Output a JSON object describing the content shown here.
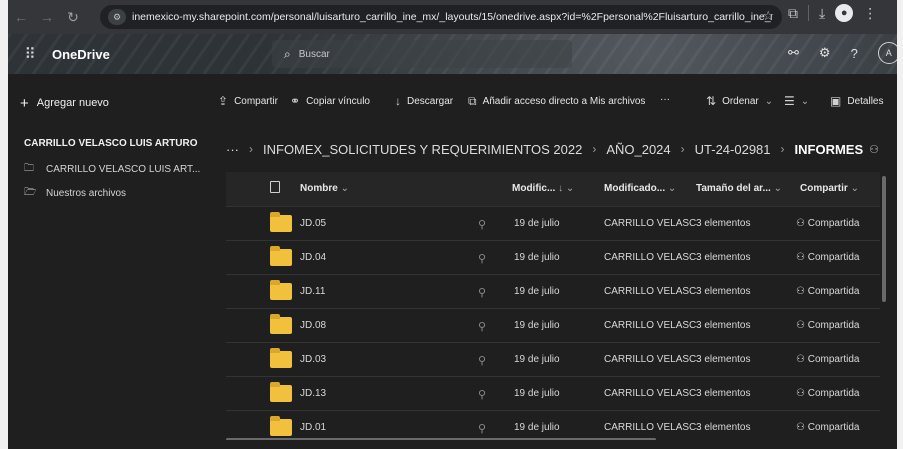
{
  "browser": {
    "url": "inemexico-my.sharepoint.com/personal/luisarturo_carrillo_ine_mx/_layouts/15/onedrive.aspx?id=%2Fpersonal%2Fluisarturo_carrillo_ine_mx%2FD..."
  },
  "suite": {
    "app_name": "OneDrive",
    "search_placeholder": "Buscar",
    "avatar_initial": "A"
  },
  "leftnav": {
    "add_new": "Agregar nuevo",
    "owner": "CARRILLO VELASCO LUIS ARTURO",
    "items": [
      {
        "label": "CARRILLO VELASCO LUIS ART...",
        "icon": "folder-icon"
      },
      {
        "label": "Nuestros archivos",
        "icon": "shared-folder-icon"
      }
    ]
  },
  "commands": {
    "share": "Compartir",
    "copy_link": "Copiar vínculo",
    "download": "Descargar",
    "add_shortcut": "Añadir acceso directo a Mis archivos",
    "more": "···",
    "sort": "Ordenar",
    "details": "Detalles"
  },
  "breadcrumb": {
    "more": "···",
    "items": [
      "INFOMEX_SOLICITUDES Y REQUERIMIENTOS 2022",
      "AÑO_2024",
      "UT-24-02981"
    ],
    "current": "INFORMES"
  },
  "list": {
    "columns": {
      "name": "Nombre",
      "modified": "Modific...",
      "modified_by": "Modificado...",
      "size": "Tamaño del ar...",
      "sharing": "Compartir"
    },
    "rows": [
      {
        "name": "JD.05",
        "modified": "19 de julio",
        "modified_by": "CARRILLO VELASC(",
        "size": "3 elementos",
        "sharing": "Compartida"
      },
      {
        "name": "JD.04",
        "modified": "19 de julio",
        "modified_by": "CARRILLO VELASC(",
        "size": "3 elementos",
        "sharing": "Compartida"
      },
      {
        "name": "JD.11",
        "modified": "19 de julio",
        "modified_by": "CARRILLO VELASC(",
        "size": "3 elementos",
        "sharing": "Compartida"
      },
      {
        "name": "JD.08",
        "modified": "19 de julio",
        "modified_by": "CARRILLO VELASC(",
        "size": "3 elementos",
        "sharing": "Compartida"
      },
      {
        "name": "JD.03",
        "modified": "19 de julio",
        "modified_by": "CARRILLO VELASC(",
        "size": "3 elementos",
        "sharing": "Compartida"
      },
      {
        "name": "JD.13",
        "modified": "19 de julio",
        "modified_by": "CARRILLO VELASC(",
        "size": "3 elementos",
        "sharing": "Compartida"
      },
      {
        "name": "JD.01",
        "modified": "19 de julio",
        "modified_by": "CARRILLO VELASC(",
        "size": "3 elementos",
        "sharing": "Compartida"
      }
    ]
  },
  "colors": {
    "background": "#1f1f1f",
    "folder": "#f1c13d",
    "browser_chrome": "#35363a"
  }
}
